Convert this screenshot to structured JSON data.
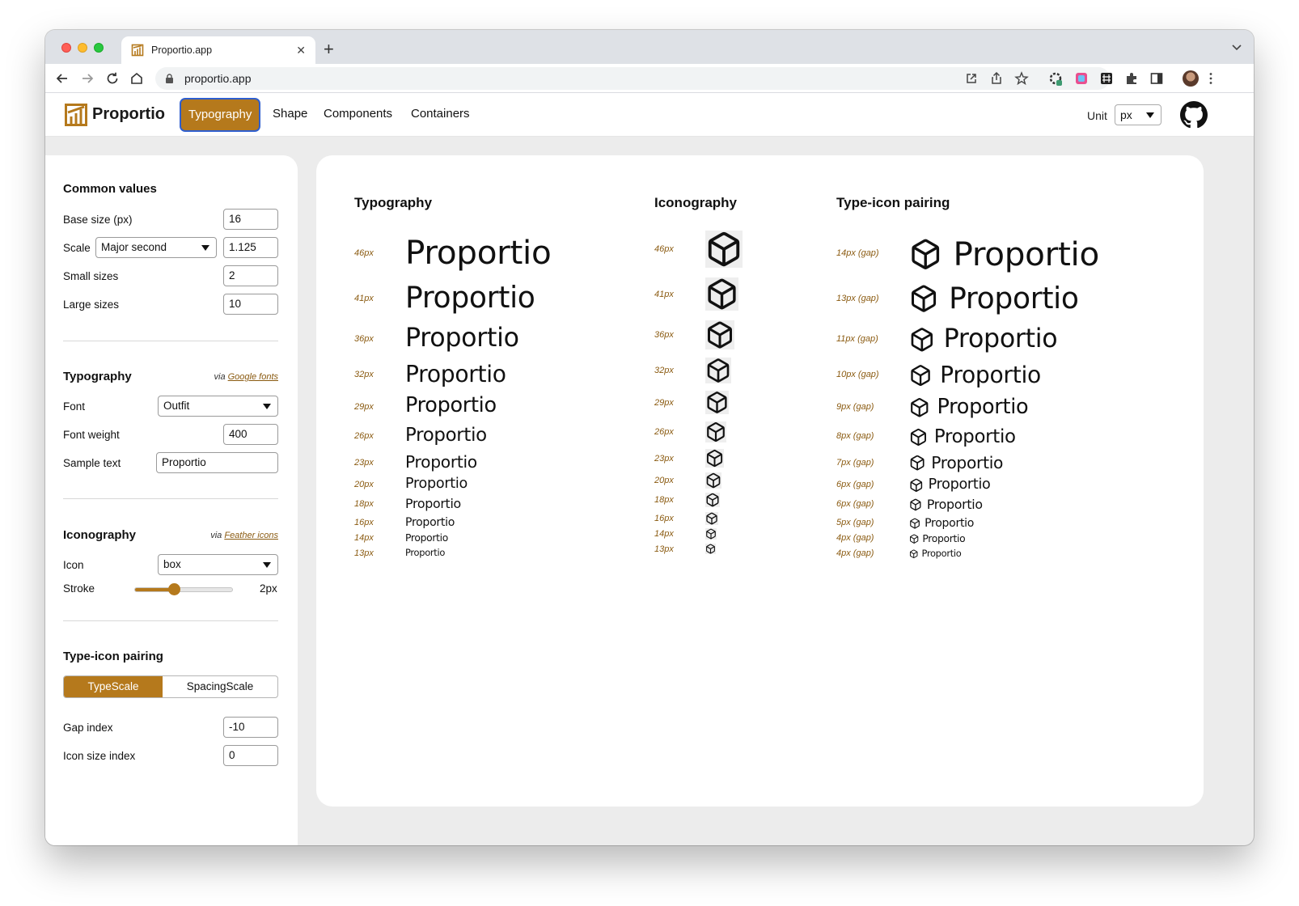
{
  "browser": {
    "tab_title": "Proportio.app",
    "url": "proportio.app"
  },
  "app": {
    "brand": "Proportio",
    "nav": [
      "Typography",
      "Shape",
      "Components",
      "Containers"
    ],
    "active_nav": "Typography",
    "unit_label": "Unit",
    "unit_value": "px",
    "accent_color": "#b5791c"
  },
  "sidebar": {
    "common": {
      "title": "Common values",
      "base_size_label": "Base size (px)",
      "base_size": "16",
      "scale_label": "Scale",
      "scale_select": "Major second",
      "scale_value": "1.125",
      "small_sizes_label": "Small sizes",
      "small_sizes": "2",
      "large_sizes_label": "Large sizes",
      "large_sizes": "10"
    },
    "typography": {
      "title": "Typography",
      "via_prefix": "via",
      "via_link": "Google fonts",
      "font_label": "Font",
      "font": "Outfit",
      "weight_label": "Font weight",
      "weight": "400",
      "sample_label": "Sample text",
      "sample": "Proportio"
    },
    "iconography": {
      "title": "Iconography",
      "via_prefix": "via",
      "via_link": "Feather icons",
      "icon_label": "Icon",
      "icon": "box",
      "stroke_label": "Stroke",
      "stroke_value": "2px",
      "stroke_fraction": 0.4
    },
    "pairing": {
      "title": "Type-icon pairing",
      "seg_on": "TypeScale",
      "seg_off": "SpacingScale",
      "gap_label": "Gap index",
      "gap": "-10",
      "icon_size_label": "Icon size index",
      "icon_size": "0"
    }
  },
  "main": {
    "typography_title": "Typography",
    "iconography_title": "Iconography",
    "pairing_title": "Type-icon pairing",
    "sample_text": "Proportio",
    "sizes": [
      "46px",
      "41px",
      "36px",
      "32px",
      "29px",
      "26px",
      "23px",
      "20px",
      "18px",
      "16px",
      "14px",
      "13px"
    ],
    "size_values": [
      46,
      41,
      36,
      32,
      29,
      26,
      23,
      20,
      18,
      16,
      14,
      13
    ],
    "gaps": [
      "14px (gap)",
      "13px (gap)",
      "11px (gap)",
      "10px (gap)",
      "9px (gap)",
      "8px (gap)",
      "7px (gap)",
      "6px (gap)",
      "6px (gap)",
      "5px (gap)",
      "4px (gap)",
      "4px (gap)"
    ],
    "icon_name": "box-icon"
  }
}
